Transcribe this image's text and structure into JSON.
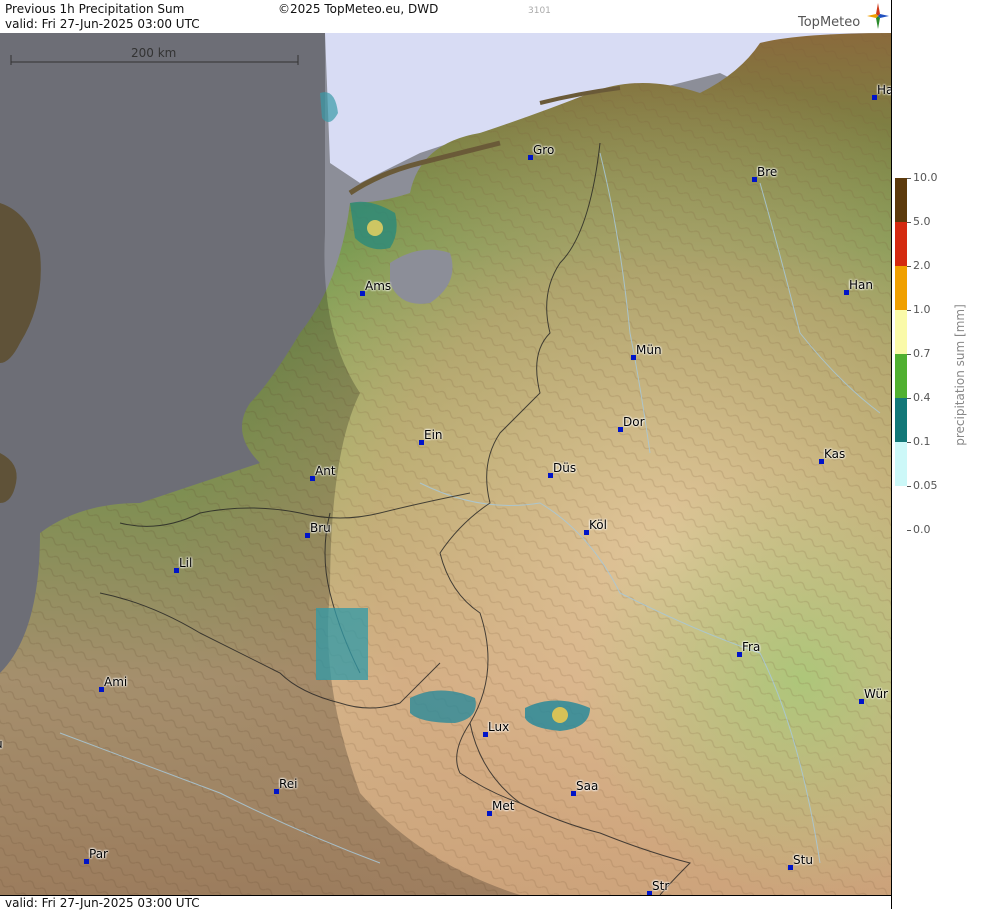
{
  "header": {
    "title": "Previous 1h Precipitation Sum",
    "valid": "valid:  Fri  27-Jun-2025 03:00 UTC",
    "copyright": "©2025 TopMeteo.eu, DWD",
    "id_number": "3101",
    "brand": "TopMeteo"
  },
  "footer": {
    "valid": "valid:  Fri  27-Jun-2025 03:00 UTC"
  },
  "scale_bar": {
    "label": "200 km"
  },
  "legend": {
    "title": "precipitation sum [mm]",
    "labels": [
      "10.0",
      "5.0",
      "2.0",
      "1.0",
      "0.7",
      "0.4",
      "0.1",
      "0.05",
      "0.0"
    ],
    "colors": [
      "#5c3a0c",
      "#d42a10",
      "#f0a000",
      "#fafaa8",
      "#50b030",
      "#127878",
      "#ccf8f8"
    ]
  },
  "cities": [
    {
      "name": "Ha"
    },
    {
      "name": "Gro"
    },
    {
      "name": "Bre"
    },
    {
      "name": "Han"
    },
    {
      "name": "Ams"
    },
    {
      "name": "Mün"
    },
    {
      "name": "Dor"
    },
    {
      "name": "Ein"
    },
    {
      "name": "Kas"
    },
    {
      "name": "Ant"
    },
    {
      "name": "Düs"
    },
    {
      "name": "Bru"
    },
    {
      "name": "Köl"
    },
    {
      "name": "Lil"
    },
    {
      "name": "Fra"
    },
    {
      "name": "Ami"
    },
    {
      "name": "Wür"
    },
    {
      "name": "Lux"
    },
    {
      "name": "u"
    },
    {
      "name": "Rei"
    },
    {
      "name": "Saa"
    },
    {
      "name": "Met"
    },
    {
      "name": "Stu"
    },
    {
      "name": "Par"
    },
    {
      "name": "Str"
    }
  ]
}
